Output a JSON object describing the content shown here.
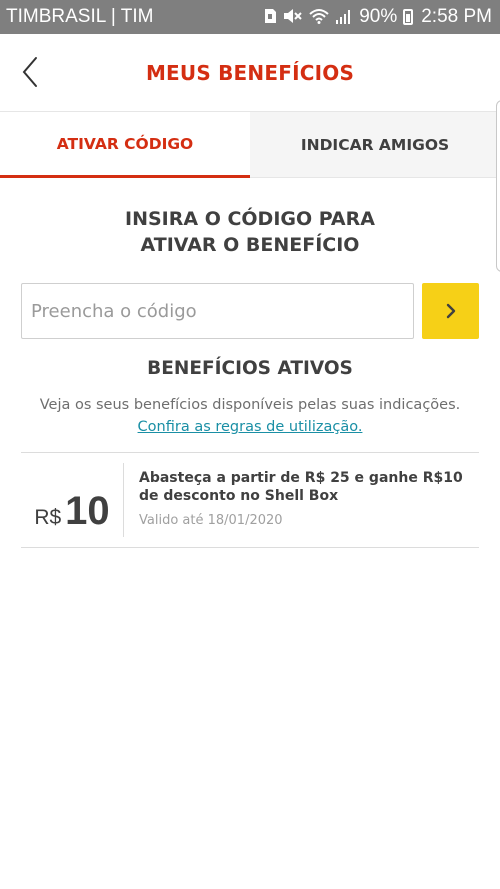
{
  "status_bar": {
    "carrier": "TIMBRASIL | TIM",
    "battery": "90%",
    "time": "2:58 PM",
    "icons": [
      "sd-card-icon",
      "mute-icon",
      "wifi-icon",
      "signal-icon",
      "battery-charging-icon"
    ]
  },
  "header": {
    "title": "MEUS BENEFÍCIOS",
    "back_icon": "chevron-left-icon"
  },
  "tabs": [
    {
      "label": "ATIVAR CÓDIGO",
      "active": true
    },
    {
      "label": "INDICAR AMIGOS",
      "active": false
    }
  ],
  "code_section": {
    "heading_line1": "INSIRA O CÓDIGO PARA",
    "heading_line2": "ATIVAR O BENEFÍCIO",
    "input_placeholder": "Preencha o código",
    "input_value": "",
    "submit_icon": "chevron-right-icon"
  },
  "benefits": {
    "heading": "BENEFÍCIOS ATIVOS",
    "description": "Veja os seus benefícios disponíveis pelas suas indicações.",
    "rules_link": "Confira as regras de utilização.",
    "items": [
      {
        "currency": "R$",
        "amount": "10",
        "title": "Abasteça a partir de R$ 25 e ganhe R$10 de desconto no Shell Box",
        "validity": "Valido até 18/01/2020"
      }
    ]
  },
  "colors": {
    "brand_red": "#d42e12",
    "brand_yellow": "#f6d017",
    "link": "#1a8fa5",
    "status_bar": "#7f7f7f"
  }
}
